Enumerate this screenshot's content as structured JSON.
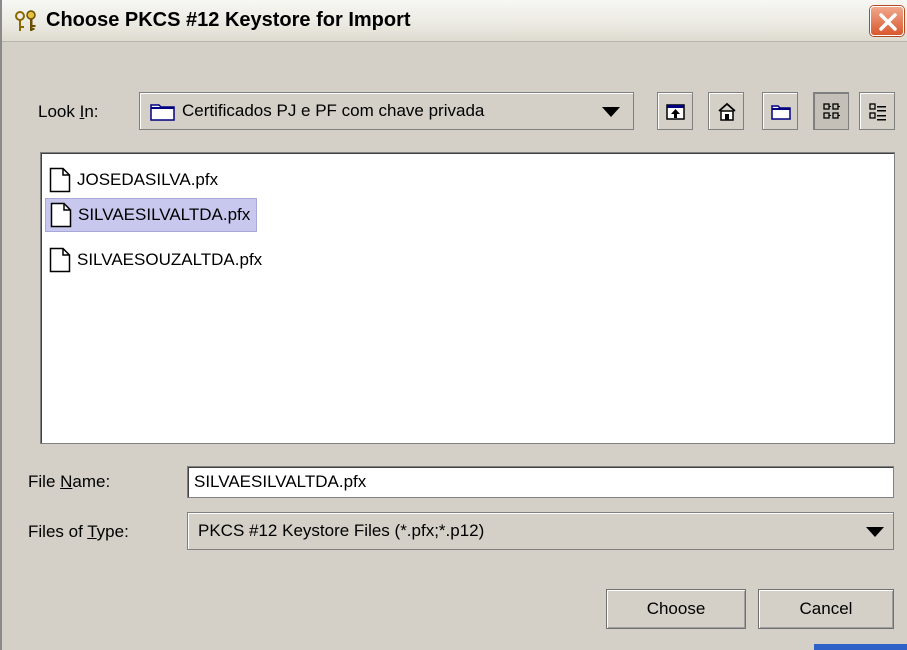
{
  "window": {
    "title": "Choose PKCS #12 Keystore for Import"
  },
  "lookin": {
    "label_prefix": "Look ",
    "label_mnemonic": "I",
    "label_suffix": "n:",
    "value": "Certificados PJ e PF com chave privada"
  },
  "toolbar": {
    "icons": [
      "up-one-level-icon",
      "home-icon",
      "new-folder-icon",
      "list-view-icon",
      "details-view-icon"
    ]
  },
  "files": [
    {
      "name": "JOSEDASILVA.pfx",
      "selected": false
    },
    {
      "name": "SILVAESILVALTDA.pfx",
      "selected": true
    },
    {
      "name": "SILVAESOUZALTDA.pfx",
      "selected": false
    }
  ],
  "filename": {
    "label_prefix": "File ",
    "label_mnemonic": "N",
    "label_suffix": "ame:",
    "value": "SILVAESILVALTDA.pfx"
  },
  "filetype": {
    "label_prefix": "Files of ",
    "label_mnemonic": "T",
    "label_suffix": "ype:",
    "value": "PKCS #12 Keystore Files (*.pfx;*.p12)"
  },
  "buttons": {
    "choose": "Choose",
    "cancel": "Cancel"
  },
  "colors": {
    "dialog_bg": "#d4d0c8",
    "selection": "#c8c8ee",
    "close_button": "#d8582e"
  }
}
